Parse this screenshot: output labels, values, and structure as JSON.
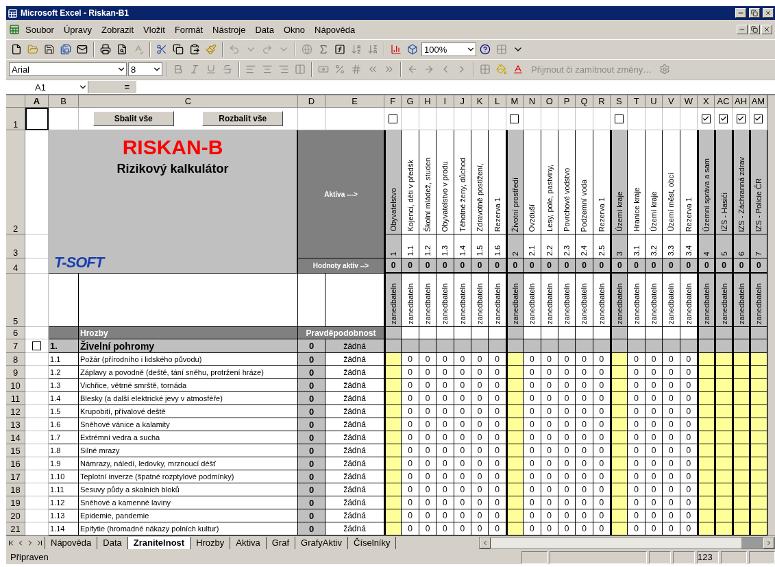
{
  "window": {
    "title": "Microsoft Excel - Riskan-B1"
  },
  "menu": [
    "Soubor",
    "Úpravy",
    "Zobrazit",
    "Vložit",
    "Formát",
    "Nástroje",
    "Data",
    "Okno",
    "Nápověda"
  ],
  "toolbar": {
    "zoom": "100%",
    "font": "Arial",
    "font_size": "8",
    "track_changes": {
      "label": "Přijmout či zamítnout změny…",
      "disabled": true
    }
  },
  "formula_bar": {
    "cell": "A1",
    "equals": "="
  },
  "sheet": {
    "columns": [
      {
        "label": "A",
        "selected": true
      },
      {
        "label": "B",
        "selected": false
      },
      {
        "label": "C",
        "selected": false
      },
      {
        "label": "D",
        "selected": false
      },
      {
        "label": "E",
        "selected": false
      },
      {
        "label": "F",
        "selected": false
      },
      {
        "label": "G",
        "selected": false
      },
      {
        "label": "H",
        "selected": false
      },
      {
        "label": "I",
        "selected": false
      },
      {
        "label": "J",
        "selected": false
      },
      {
        "label": "K",
        "selected": false
      },
      {
        "label": "L",
        "selected": false
      },
      {
        "label": "M",
        "selected": false
      },
      {
        "label": "N",
        "selected": false
      },
      {
        "label": "O",
        "selected": false
      },
      {
        "label": "P",
        "selected": false
      },
      {
        "label": "Q",
        "selected": false
      },
      {
        "label": "R",
        "selected": false
      },
      {
        "label": "S",
        "selected": false
      },
      {
        "label": "T",
        "selected": false
      },
      {
        "label": "U",
        "selected": false
      },
      {
        "label": "V",
        "selected": false
      },
      {
        "label": "W",
        "selected": false
      },
      {
        "label": "X",
        "selected": false
      },
      {
        "label": "AC",
        "selected": false
      },
      {
        "label": "AH",
        "selected": false
      },
      {
        "label": "AM",
        "selected": false
      }
    ],
    "row_numbers": [
      "1",
      "2",
      "3",
      "4",
      "5",
      "6",
      "7",
      "8",
      "9",
      "10",
      "11",
      "12",
      "13",
      "14",
      "15",
      "16",
      "17",
      "18",
      "19",
      "20",
      "21"
    ],
    "buttons": [
      "Sbalit vše",
      "Rozbalit vše"
    ],
    "title": "RISKAN-B",
    "subtitle": "Rizikový kalkulátor",
    "logo": "T-SOFT",
    "assets_label": "Aktiva --->",
    "asset_values_label": "Hodnoty aktiv -->",
    "assets": [
      {
        "kind": "group",
        "checked": false,
        "label": "Obyvatelstvo",
        "number": "1",
        "value": "0",
        "rating": "zanedbateln"
      },
      {
        "kind": "item",
        "label": "Kojenci, děti v předšk",
        "number": "1.1",
        "value": "0",
        "rating": "zanedbateln"
      },
      {
        "kind": "item",
        "label": "Školní mládež, studen",
        "number": "1.2",
        "value": "0",
        "rating": "zanedbateln"
      },
      {
        "kind": "item",
        "label": "Obyvatelstvo v produ",
        "number": "1.3",
        "value": "0",
        "rating": "zanedbateln"
      },
      {
        "kind": "item",
        "label": "Těhotné ženy, důchod",
        "number": "1.4",
        "value": "0",
        "rating": "zanedbateln"
      },
      {
        "kind": "item",
        "label": "Zdravotně postižení,",
        "number": "1.5",
        "value": "0",
        "rating": "zanedbateln"
      },
      {
        "kind": "item",
        "label": "Rezerva 1",
        "number": "1.6",
        "value": "0",
        "rating": "zanedbateln"
      },
      {
        "kind": "group",
        "checked": false,
        "label": "Životní prostředí",
        "number": "2",
        "value": "0",
        "rating": "zanedbateln"
      },
      {
        "kind": "item",
        "label": "Ovzduší",
        "number": "2.1",
        "value": "0",
        "rating": "zanedbateln"
      },
      {
        "kind": "item",
        "label": "Lesy, pole, pastviny,",
        "number": "2.2",
        "value": "0",
        "rating": "zanedbateln"
      },
      {
        "kind": "item",
        "label": "Povrchové vodstvo",
        "number": "2.3",
        "value": "0",
        "rating": "zanedbateln"
      },
      {
        "kind": "item",
        "label": "Podzemní voda",
        "number": "2.4",
        "value": "0",
        "rating": "zanedbateln"
      },
      {
        "kind": "item",
        "label": "Rezerva 1",
        "number": "2.5",
        "value": "0",
        "rating": "zanedbateln"
      },
      {
        "kind": "group",
        "checked": false,
        "label": "Území kraje",
        "number": "3",
        "value": "0",
        "rating": "zanedbateln"
      },
      {
        "kind": "item",
        "label": "Hranice kraje",
        "number": "3.1",
        "value": "0",
        "rating": "zanedbateln"
      },
      {
        "kind": "item",
        "label": "Území kraje",
        "number": "3.2",
        "value": "0",
        "rating": "zanedbateln"
      },
      {
        "kind": "item",
        "label": "Území měst, obcí",
        "number": "3.3",
        "value": "0",
        "rating": "zanedbateln"
      },
      {
        "kind": "item",
        "label": "Rezerva 1",
        "number": "3.4",
        "value": "0",
        "rating": "zanedbateln"
      },
      {
        "kind": "group",
        "checked": true,
        "label": "Územní správa a sam",
        "number": "4",
        "value": "0",
        "rating": "zanedbateln"
      },
      {
        "kind": "group",
        "checked": true,
        "label": "IZS - Hasiči",
        "number": "5",
        "value": "0",
        "rating": "zanedbateln"
      },
      {
        "kind": "group",
        "checked": true,
        "label": "IZS - Záchranná zdrav",
        "number": "6",
        "value": "0",
        "rating": "zanedbateln"
      },
      {
        "kind": "group",
        "checked": true,
        "label": "IZS - Policie ČR",
        "number": "7",
        "value": "0",
        "rating": "zanedbateln"
      }
    ],
    "threats_header": "Hrozby",
    "probability_header": "Pravděpodobnost",
    "category": {
      "checked": false,
      "number": "1.",
      "name": "Živelní pohromy",
      "value": "0",
      "probability": "žádná"
    },
    "threats": [
      {
        "number": "1.1",
        "name": "Požár (přírodního i lidského původu)",
        "value": "0",
        "probability": "žádná",
        "scores": [
          "0",
          "0",
          "0",
          "0",
          "0",
          "0",
          "0",
          "0",
          "0",
          "0",
          "0",
          "0",
          "0",
          "0",
          "0"
        ]
      },
      {
        "number": "1.2",
        "name": "Záplavy a  povodně (deště, tání sněhu, protržení hráze)",
        "value": "0",
        "probability": "žádná",
        "scores": [
          "0",
          "0",
          "0",
          "0",
          "0",
          "0",
          "0",
          "0",
          "0",
          "0",
          "0",
          "0",
          "0",
          "0",
          "0"
        ]
      },
      {
        "number": "1.3",
        "name": "Vichřice, větrné smrště, tornáda",
        "value": "0",
        "probability": "žádná",
        "scores": [
          "0",
          "0",
          "0",
          "0",
          "0",
          "0",
          "0",
          "0",
          "0",
          "0",
          "0",
          "0",
          "0",
          "0",
          "0"
        ]
      },
      {
        "number": "1.4",
        "name": "Blesky (a další elektrické jevy v atmosféře)",
        "value": "0",
        "probability": "žádná",
        "scores": [
          "0",
          "0",
          "0",
          "0",
          "0",
          "0",
          "0",
          "0",
          "0",
          "0",
          "0",
          "0",
          "0",
          "0",
          "0"
        ]
      },
      {
        "number": "1.5",
        "name": "Krupobití, přívalové deště",
        "value": "0",
        "probability": "žádná",
        "scores": [
          "0",
          "0",
          "0",
          "0",
          "0",
          "0",
          "0",
          "0",
          "0",
          "0",
          "0",
          "0",
          "0",
          "0",
          "0"
        ]
      },
      {
        "number": "1.6",
        "name": "Sněhové vánice a kalamity",
        "value": "0",
        "probability": "žádná",
        "scores": [
          "0",
          "0",
          "0",
          "0",
          "0",
          "0",
          "0",
          "0",
          "0",
          "0",
          "0",
          "0",
          "0",
          "0",
          "0"
        ]
      },
      {
        "number": "1.7",
        "name": "Extrémní vedra a sucha",
        "value": "0",
        "probability": "žádná",
        "scores": [
          "0",
          "0",
          "0",
          "0",
          "0",
          "0",
          "0",
          "0",
          "0",
          "0",
          "0",
          "0",
          "0",
          "0",
          "0"
        ]
      },
      {
        "number": "1.8",
        "name": "Silné mrazy",
        "value": "0",
        "probability": "žádná",
        "scores": [
          "0",
          "0",
          "0",
          "0",
          "0",
          "0",
          "0",
          "0",
          "0",
          "0",
          "0",
          "0",
          "0",
          "0",
          "0"
        ]
      },
      {
        "number": "1.9",
        "name": "Námrazy, náledí, ledovky, mrznoucí déšť",
        "value": "0",
        "probability": "žádná",
        "scores": [
          "0",
          "0",
          "0",
          "0",
          "0",
          "0",
          "0",
          "0",
          "0",
          "0",
          "0",
          "0",
          "0",
          "0",
          "0"
        ]
      },
      {
        "number": "1.10",
        "name": "Teplotní inverze (špatné rozptylové podmínky)",
        "value": "0",
        "probability": "žádná",
        "scores": [
          "0",
          "0",
          "0",
          "0",
          "0",
          "0",
          "0",
          "0",
          "0",
          "0",
          "0",
          "0",
          "0",
          "0",
          "0"
        ]
      },
      {
        "number": "1.11",
        "name": "Sesuvy půdy a skalních bloků",
        "value": "0",
        "probability": "žádná",
        "scores": [
          "0",
          "0",
          "0",
          "0",
          "0",
          "0",
          "0",
          "0",
          "0",
          "0",
          "0",
          "0",
          "0",
          "0",
          "0"
        ]
      },
      {
        "number": "1.12",
        "name": "Sněhové a kamenné laviny",
        "value": "0",
        "probability": "žádná",
        "scores": [
          "0",
          "0",
          "0",
          "0",
          "0",
          "0",
          "0",
          "0",
          "0",
          "0",
          "0",
          "0",
          "0",
          "0",
          "0"
        ]
      },
      {
        "number": "1.13",
        "name": "Epidemie, pandemie",
        "value": "0",
        "probability": "žádná",
        "scores": [
          "0",
          "0",
          "0",
          "0",
          "0",
          "0",
          "0",
          "0",
          "0",
          "0",
          "0",
          "0",
          "0",
          "0",
          "0"
        ]
      },
      {
        "number": "1.14",
        "name": "Epifytie (hromadné nákazy polních kultur)",
        "value": "0",
        "probability": "žádná",
        "scores": [
          "0",
          "0",
          "0",
          "0",
          "0",
          "0",
          "0",
          "0",
          "0",
          "0",
          "0",
          "0",
          "0",
          "0",
          "0"
        ]
      }
    ]
  },
  "sheet_tabs": [
    {
      "label": "Nápověda",
      "selected": false
    },
    {
      "label": "Data",
      "selected": false
    },
    {
      "label": "Zranitelnost",
      "selected": true
    },
    {
      "label": "Hrozby",
      "selected": false
    },
    {
      "label": "Aktiva",
      "selected": false
    },
    {
      "label": "Graf",
      "selected": false
    },
    {
      "label": "GrafyAktiv",
      "selected": false
    },
    {
      "label": "Číselníky",
      "selected": false
    }
  ],
  "status_bar": {
    "text": "Připraven",
    "indicator": "123"
  }
}
